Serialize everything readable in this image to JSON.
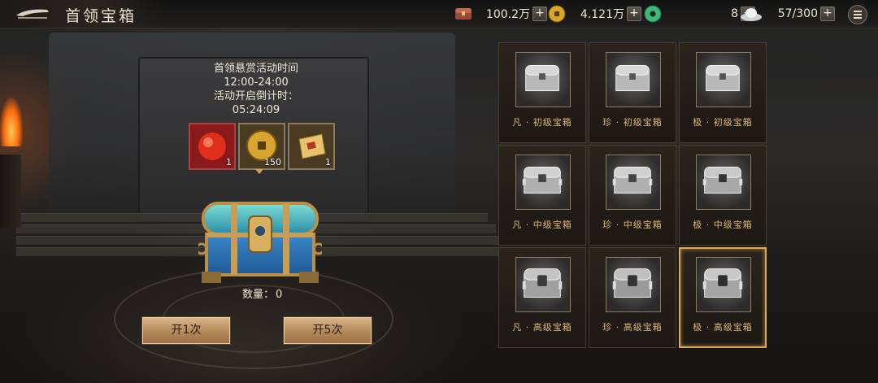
{
  "header": {
    "title": "首领宝箱",
    "resources": [
      {
        "icon": "treasure-chest-currency-icon",
        "value": "100.2万"
      },
      {
        "icon": "gold-coin-icon",
        "value": "4.121万"
      },
      {
        "icon": "jade-disc-icon",
        "value": "8"
      },
      {
        "icon": "silver-ingot-icon",
        "value": "57/300"
      }
    ],
    "plus_label": "+"
  },
  "event": {
    "title": "首领悬赏活动时间",
    "time_range": "12:00-24:00",
    "countdown_label": "活动开启倒计时：",
    "countdown": "05:24:09"
  },
  "rewards": [
    {
      "icon": "red-orb-icon",
      "count": "1"
    },
    {
      "icon": "gold-coin-icon",
      "count": "150"
    },
    {
      "icon": "scroll-icon",
      "count": "1"
    }
  ],
  "quantity": {
    "label": "数量：",
    "value": "0"
  },
  "buttons": {
    "open_once": "开1次",
    "open_five": "开5次"
  },
  "chests": [
    {
      "label": "凡 · 初级宝箱",
      "selected": false
    },
    {
      "label": "珍 · 初级宝箱",
      "selected": false
    },
    {
      "label": "极 · 初级宝箱",
      "selected": false
    },
    {
      "label": "凡 · 中级宝箱",
      "selected": false
    },
    {
      "label": "珍 · 中级宝箱",
      "selected": false
    },
    {
      "label": "极 · 中级宝箱",
      "selected": false
    },
    {
      "label": "凡 · 高级宝箱",
      "selected": false
    },
    {
      "label": "珍 · 高级宝箱",
      "selected": false
    },
    {
      "label": "极 · 高级宝箱",
      "selected": true
    }
  ],
  "colors": {
    "accent": "#d9a95a",
    "label": "#e0b673",
    "button": "#b48958"
  }
}
